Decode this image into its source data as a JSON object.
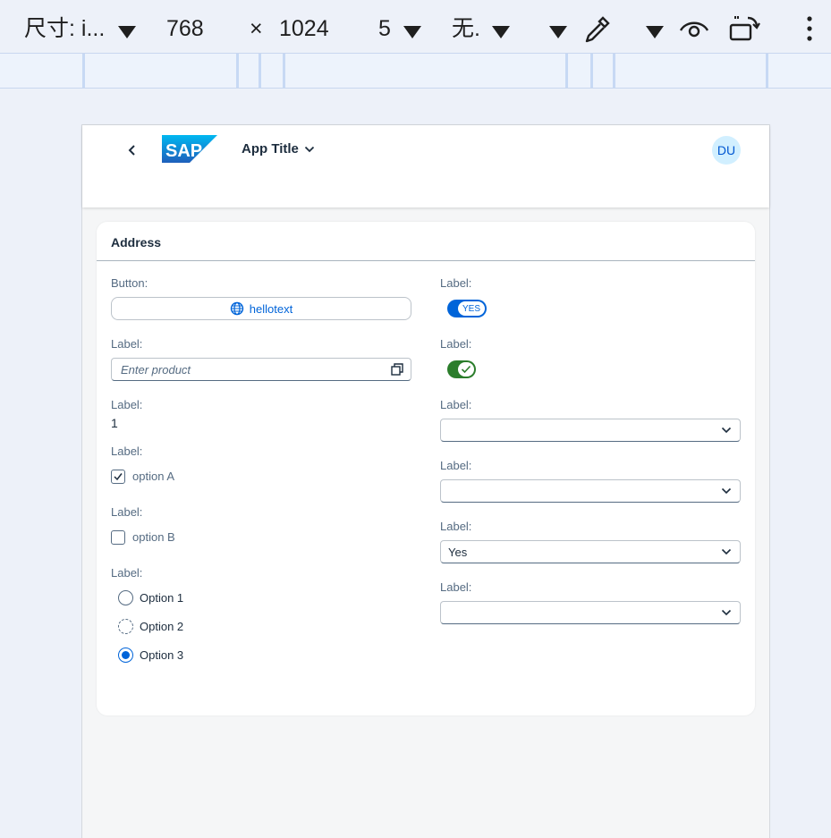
{
  "devtools": {
    "dimensions_label": "尺寸: i...",
    "width": "768",
    "times": "×",
    "height": "1024",
    "zoom": "5",
    "throttle": "无."
  },
  "app": {
    "title": "App Title",
    "avatar_initials": "DU",
    "brand": "SAP"
  },
  "card": {
    "title": "Address",
    "left": {
      "button_label": "Button:",
      "button_text": "hellotext",
      "input_label": "Label:",
      "input_placeholder": "Enter product",
      "text_label": "Label:",
      "text_value": "1",
      "checkbox_a_label": "Label:",
      "checkbox_a_text": "option A",
      "checkbox_a_checked": true,
      "checkbox_b_label": "Label:",
      "checkbox_b_text": "option B",
      "checkbox_b_checked": false,
      "radio_label": "Label:",
      "radios": [
        "Option 1",
        "Option 2",
        "Option 3"
      ],
      "radio_selected": "Option 3"
    },
    "right": {
      "switch1_label": "Label:",
      "switch1_text": "YES",
      "switch2_label": "Label:",
      "select1_label": "Label:",
      "select1_value": "",
      "select2_label": "Label:",
      "select2_value": "",
      "select3_label": "Label:",
      "select3_value": "Yes",
      "select4_label": "Label:",
      "select4_value": ""
    }
  },
  "colors": {
    "brand_blue": "#0064d9",
    "switch_green": "#2b7d2b",
    "background": "#f5f6f7"
  }
}
